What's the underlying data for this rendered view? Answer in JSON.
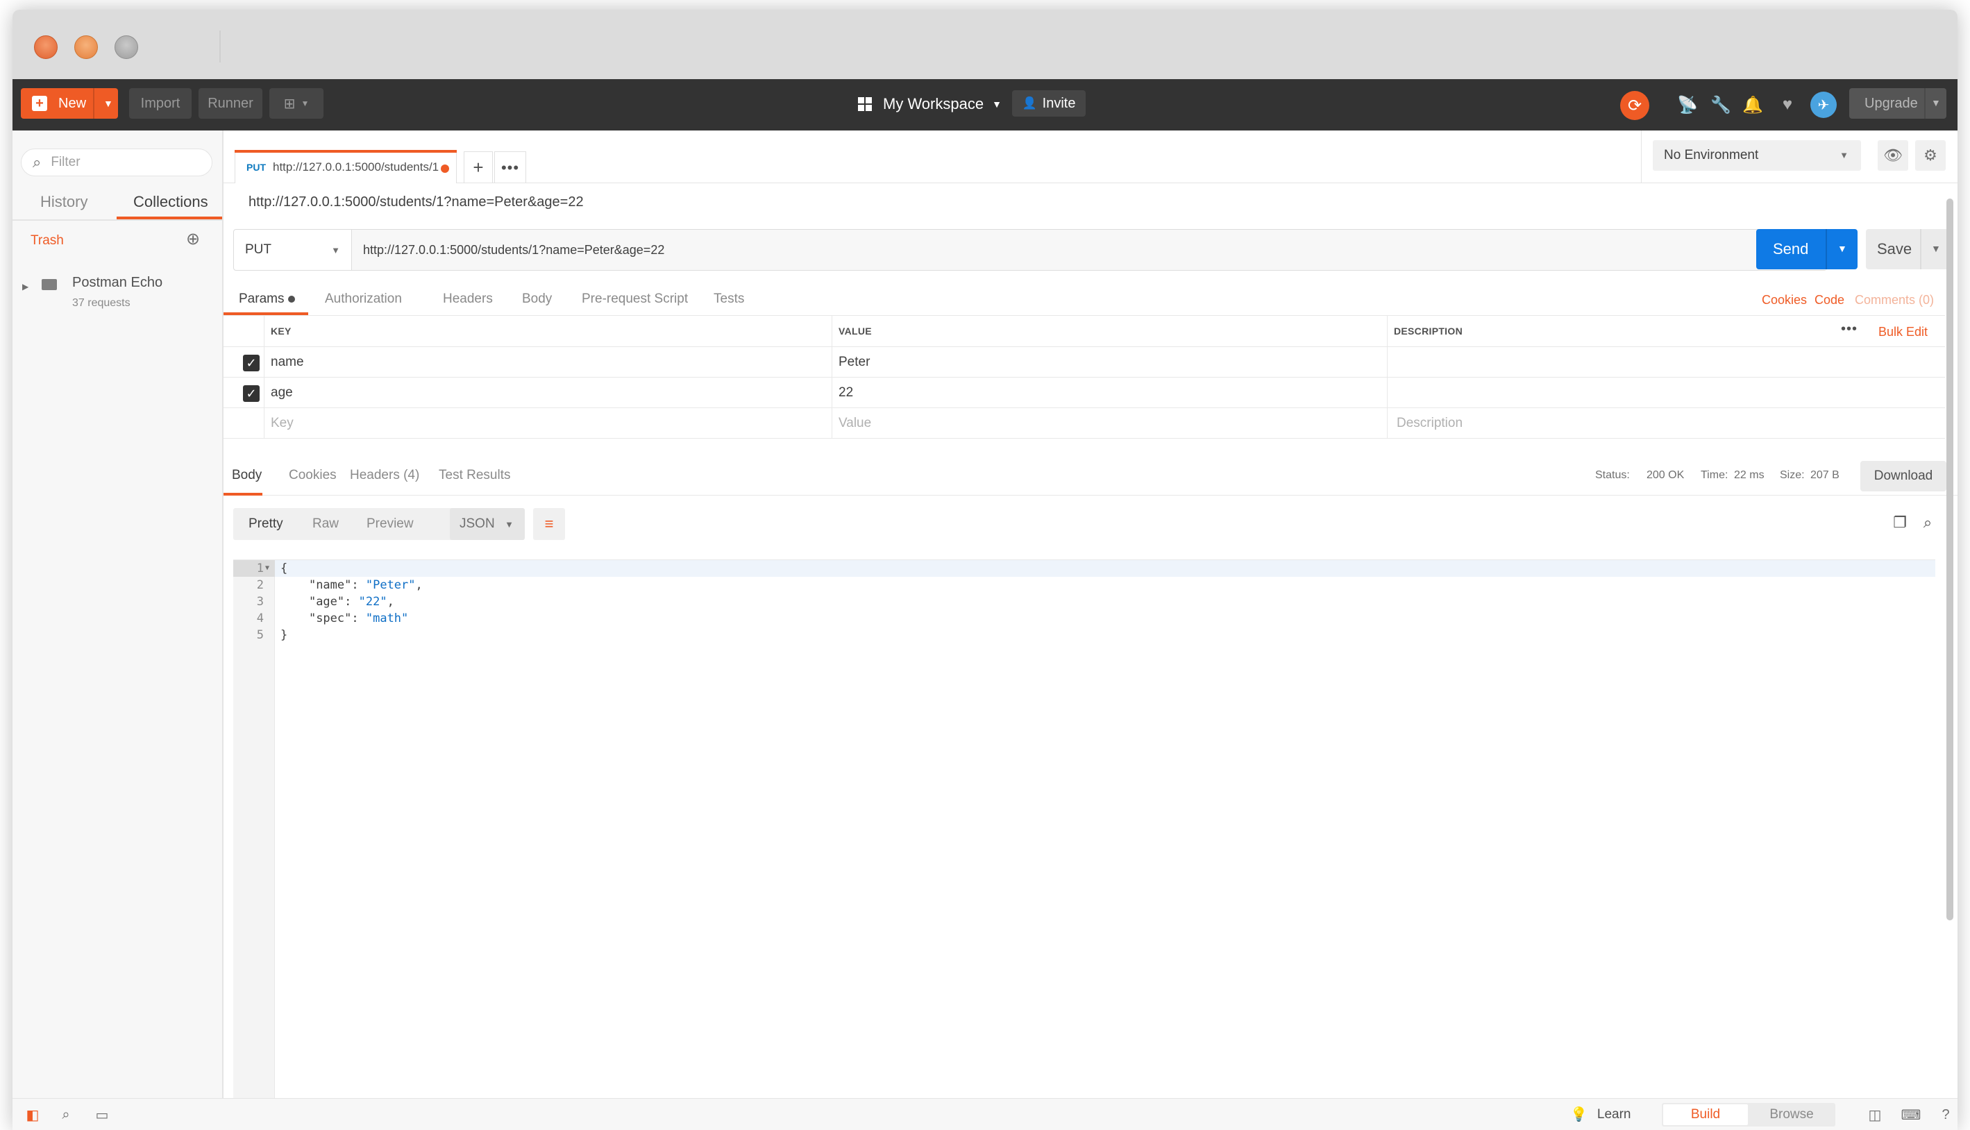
{
  "header": {
    "new_label": "New",
    "import_label": "Import",
    "runner_label": "Runner",
    "workspace_label": "My Workspace",
    "invite_label": "Invite",
    "upgrade_label": "Upgrade"
  },
  "sidebar": {
    "filter_placeholder": "Filter",
    "tabs": [
      "History",
      "Collections"
    ],
    "active_tab": "Collections",
    "trash_label": "Trash",
    "collections": [
      {
        "name": "Postman Echo",
        "count": "37 requests"
      }
    ]
  },
  "request_tab": {
    "method": "PUT",
    "url": "http://127.0.0.1:5000/students/1",
    "unsaved": true
  },
  "environment": {
    "selected": "No Environment"
  },
  "request": {
    "name": "http://127.0.0.1:5000/students/1?name=Peter&age=22",
    "method": "PUT",
    "url": "http://127.0.0.1:5000/students/1?name=Peter&age=22",
    "send_label": "Send",
    "save_label": "Save",
    "tabs": [
      "Params",
      "Authorization",
      "Headers",
      "Body",
      "Pre-request Script",
      "Tests"
    ],
    "links": {
      "cookies": "Cookies",
      "code": "Code",
      "comments": "Comments (0)"
    }
  },
  "params": {
    "headers": {
      "key": "KEY",
      "value": "VALUE",
      "description": "DESCRIPTION"
    },
    "bulk_edit": "Bulk Edit",
    "rows": [
      {
        "key": "name",
        "value": "Peter",
        "description": ""
      },
      {
        "key": "age",
        "value": "22",
        "description": ""
      }
    ],
    "placeholders": {
      "key": "Key",
      "value": "Value",
      "description": "Description"
    }
  },
  "response": {
    "tabs": [
      "Body",
      "Cookies",
      "Headers (4)",
      "Test Results"
    ],
    "status_label": "Status:",
    "status_value": "200 OK",
    "time_label": "Time:",
    "time_value": "22 ms",
    "size_label": "Size:",
    "size_value": "207 B",
    "download_label": "Download",
    "view_modes": [
      "Pretty",
      "Raw",
      "Preview"
    ],
    "format": "JSON",
    "body_lines": [
      {
        "n": "1",
        "key": "",
        "val": "",
        "pre": "{"
      },
      {
        "n": "2",
        "key": "\"name\"",
        "val": "\"Peter\"",
        "pre": "    ",
        "post": ","
      },
      {
        "n": "3",
        "key": "\"age\"",
        "val": "\"22\"",
        "pre": "    ",
        "post": ","
      },
      {
        "n": "4",
        "key": "\"spec\"",
        "val": "\"math\"",
        "pre": "    ",
        "post": ""
      },
      {
        "n": "5",
        "key": "",
        "val": "",
        "pre": "}"
      }
    ]
  },
  "footer": {
    "learn_label": "Learn",
    "build_label": "Build",
    "browse_label": "Browse"
  },
  "colors": {
    "accent": "#ef5b25",
    "send": "#0f7ae5",
    "header_bg": "#333333"
  }
}
